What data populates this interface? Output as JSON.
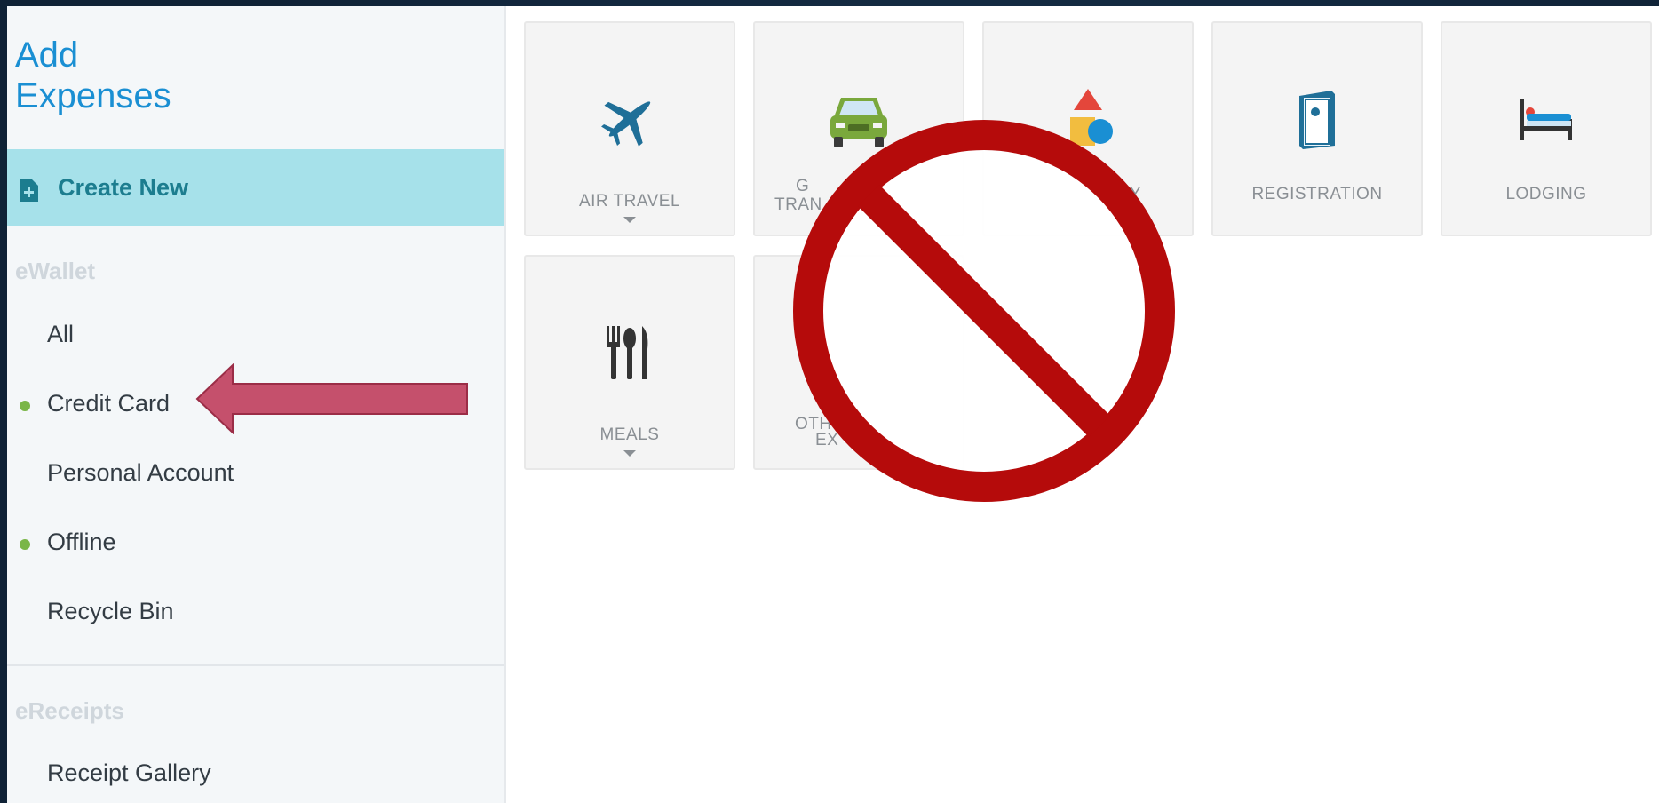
{
  "sidebar": {
    "title": "Add\nExpenses",
    "create_new": "Create New",
    "ewallet_section": "eWallet",
    "items": [
      {
        "label": "All",
        "dot": false
      },
      {
        "label": "Credit Card",
        "dot": true
      },
      {
        "label": "Personal Account",
        "dot": false
      },
      {
        "label": "Offline",
        "dot": true
      },
      {
        "label": "Recycle Bin",
        "dot": false
      }
    ],
    "ereceipts_section": "eReceipts",
    "receipt_gallery": "Receipt Gallery"
  },
  "tiles": [
    {
      "label": "AIR TRAVEL",
      "icon": "airplane-icon",
      "has_dropdown": true
    },
    {
      "label": "GROUND TRANSPORTATION",
      "visible_label_parts": [
        "G",
        "TRAN"
      ],
      "icon": "car-icon",
      "has_dropdown": false
    },
    {
      "label": "CATEGORY",
      "visible_label_parts": [
        "RY"
      ],
      "icon": "shapes-icon",
      "has_dropdown": false
    },
    {
      "label": "REGISTRATION",
      "icon": "registration-icon",
      "has_dropdown": false
    },
    {
      "label": "LODGING",
      "icon": "bed-icon",
      "has_dropdown": false
    },
    {
      "label": "MEALS",
      "icon": "utensils-icon",
      "has_dropdown": true
    },
    {
      "label": "OTHER EXPENSES",
      "visible_label_parts": [
        "OTH",
        "EX"
      ],
      "icon": "other-icon",
      "has_dropdown": false
    }
  ],
  "overlay": {
    "no_sign_icon": "prohibited-icon",
    "pointer_arrow_icon": "left-arrow-icon"
  },
  "colors": {
    "accent_blue": "#1a8fd3",
    "create_new_bg": "#a6e1ea",
    "status_dot": "#7ab648",
    "no_sign_red": "#b50b0b",
    "arrow_fill": "#c5506c"
  }
}
